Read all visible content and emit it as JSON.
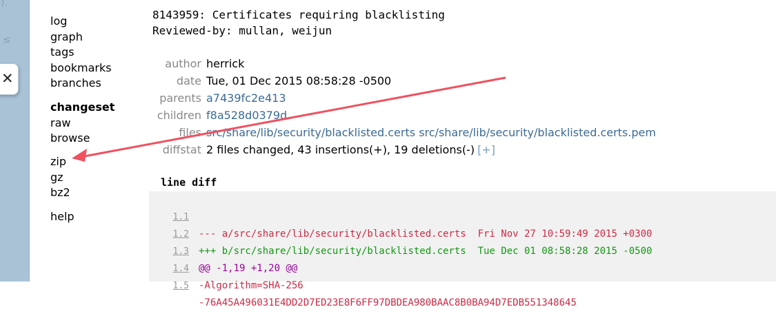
{
  "sidebar_glyphs": {
    "top": ").",
    "mid": "≤"
  },
  "close_tab": {
    "symbol": "✕"
  },
  "nav": {
    "group1": [
      "log",
      "graph",
      "tags",
      "bookmarks",
      "branches"
    ],
    "group2": [
      "changeset",
      "raw",
      "browse"
    ],
    "group3": [
      "zip",
      "gz",
      "bz2"
    ],
    "group4": [
      "help"
    ],
    "active": "changeset"
  },
  "description": {
    "line1": "8143959: Certificates requiring blacklisting",
    "line2": "Reviewed-by: mullan, weijun"
  },
  "meta": {
    "author_label": "author",
    "author": "herrick",
    "date_label": "date",
    "date": "Tue, 01 Dec 2015 08:58:28 -0500",
    "parents_label": "parents",
    "parents": "a7439fc2e413",
    "children_label": "children",
    "children": "f8a528d0379d",
    "files_label": "files",
    "file1": "src/share/lib/security/blacklisted.certs",
    "file2": "src/share/lib/security/blacklisted.certs.pem",
    "diffstat_label": "diffstat",
    "diffstat": "2 files changed, 43 insertions(+), 19 deletions(-)",
    "diffstat_toggle": "[+]"
  },
  "diff": {
    "heading": "line diff",
    "lines": [
      {
        "num": "1.1",
        "text": "--- a/src/share/lib/security/blacklisted.certs  Fri Nov 27 10:59:49 2015 +0300",
        "kind": "minus"
      },
      {
        "num": "1.2",
        "text": "+++ b/src/share/lib/security/blacklisted.certs  Tue Dec 01 08:58:28 2015 -0500",
        "kind": "plus"
      },
      {
        "num": "1.3",
        "text": "@@ -1,19 +1,20 @@",
        "kind": "hunk"
      },
      {
        "num": "1.4",
        "text": "-Algorithm=SHA-256",
        "kind": "minus"
      },
      {
        "num": "1.5",
        "text": "-76A45A496031E4DD2D7ED23E8F6FF97DBDEA980BAAC8B0BA94D7EDB551348645",
        "kind": "minus"
      }
    ]
  },
  "colors": {
    "link": "#3b6b95",
    "minus": "#cc2a44",
    "plus": "#119911",
    "hunk": "#990099",
    "annotation": "#f0505f",
    "strip": "#a9c2d6"
  }
}
